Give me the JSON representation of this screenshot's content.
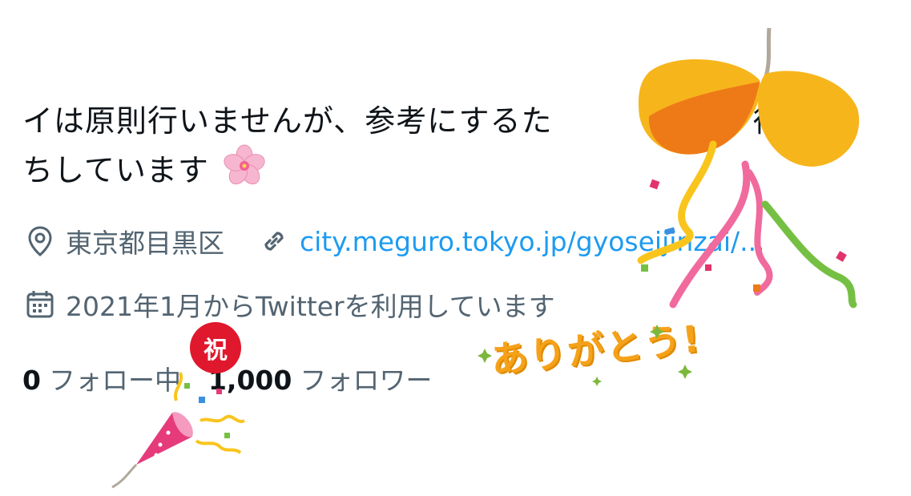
{
  "profile": {
    "bio_line1": "イは原則行いませんが、参考にするた",
    "bio_line1_tail": "待",
    "bio_line2": "ちしています",
    "bio_emoji": "cherry-blossom-icon",
    "location": "東京都目黒区",
    "website": "city.meguro.tokyo.jp/gyoseijinzai/...",
    "joined": "2021年1月からTwitterを利用しています",
    "following_count": "0",
    "following_label": "フォロー中",
    "followers_count": "1,000",
    "followers_label": "フォロワー"
  },
  "stickers": {
    "thanks": "ありがとう!",
    "celebrate": "祝"
  },
  "colors": {
    "text": "#0f1419",
    "secondary": "#536471",
    "link": "#1d9bf0",
    "accent_yellow": "#f5a21a",
    "accent_red": "#e0182d"
  }
}
